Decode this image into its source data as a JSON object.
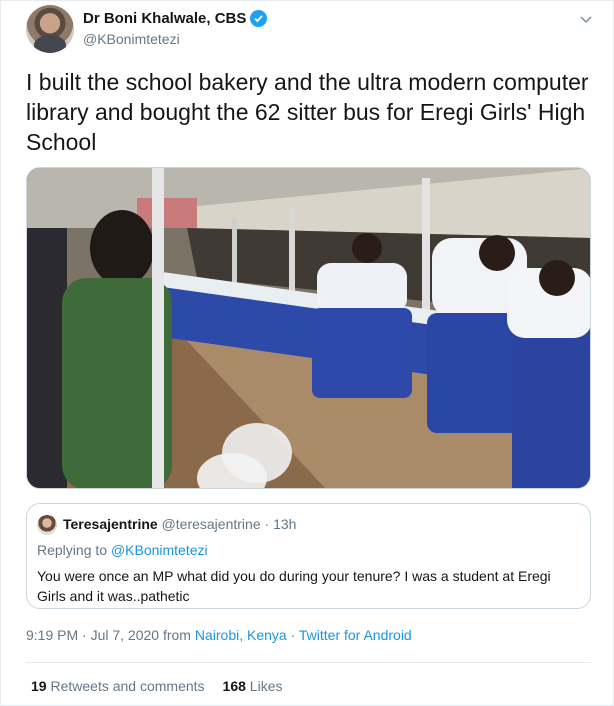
{
  "author": {
    "name": "Dr Boni Khalwale, CBS",
    "handle": "@KBonimtetezi",
    "verified_icon": "verified-badge-icon"
  },
  "tweet": {
    "text": "I built the school bakery and the ultra modern computer library and bought the 62 sitter bus for Eregi Girls' High School"
  },
  "quoted": {
    "name": "Teresajentrine",
    "handle": "@teresajentrine",
    "separator": " · ",
    "time": "13h",
    "replying_prefix": "Replying to ",
    "replying_to": "@KBonimtetezi",
    "text": "You were once an MP what did you do during your tenure? I was a student at Eregi Girls and it was..pathetic"
  },
  "meta": {
    "time": "9:19 PM · Jul 7, 2020",
    "from_label": " from ",
    "location": "Nairobi, Kenya",
    "separator": " · ",
    "source": "Twitter for Android"
  },
  "stats": {
    "retweets_count": "19",
    "retweets_label": "Retweets and comments",
    "likes_count": "168",
    "likes_label": "Likes"
  },
  "colors": {
    "link": "#1b95e0",
    "verified": "#1da1f2",
    "muted": "#657786",
    "border": "#ccd6dd"
  }
}
